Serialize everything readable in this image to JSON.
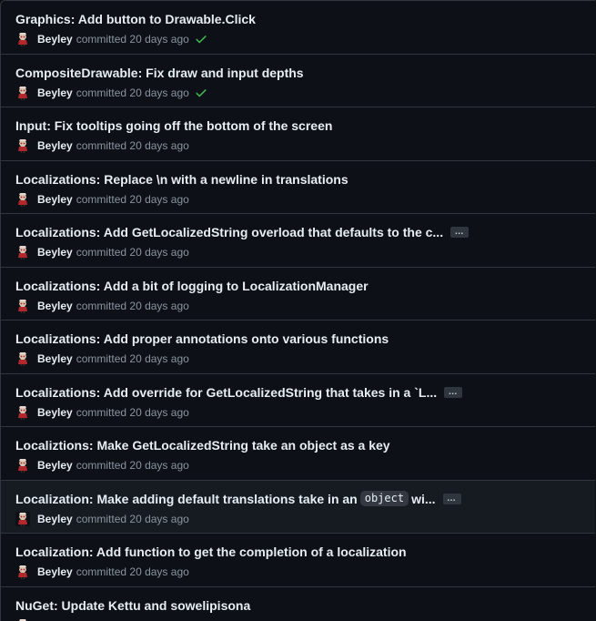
{
  "commits": [
    {
      "title": "Graphics: Add button to Drawable.Click",
      "author": "Beyley",
      "action": "committed",
      "time": "20 days ago",
      "status": "success",
      "truncated": false
    },
    {
      "title": "CompositeDrawable: Fix draw and input depths",
      "author": "Beyley",
      "action": "committed",
      "time": "20 days ago",
      "status": "success",
      "truncated": false
    },
    {
      "title": "Input: Fix tooltips going off the bottom of the screen",
      "author": "Beyley",
      "action": "committed",
      "time": "20 days ago",
      "status": "",
      "truncated": false
    },
    {
      "title": "Localizations: Replace \\n with a newline in translations",
      "author": "Beyley",
      "action": "committed",
      "time": "20 days ago",
      "status": "",
      "truncated": false
    },
    {
      "title": "Localizations: Add GetLocalizedString overload that defaults to the c...",
      "author": "Beyley",
      "action": "committed",
      "time": "20 days ago",
      "status": "",
      "truncated": true
    },
    {
      "title": "Localizations: Add a bit of logging to LocalizationManager",
      "author": "Beyley",
      "action": "committed",
      "time": "20 days ago",
      "status": "",
      "truncated": false
    },
    {
      "title": "Localizations: Add proper annotations onto various functions",
      "author": "Beyley",
      "action": "committed",
      "time": "20 days ago",
      "status": "",
      "truncated": false
    },
    {
      "title": "Localizations: Add override for GetLocalizedString that takes in a `L...",
      "author": "Beyley",
      "action": "committed",
      "time": "20 days ago",
      "status": "",
      "truncated": true
    },
    {
      "title": "Localiztions: Make GetLocalizedString take an object as a key",
      "author": "Beyley",
      "action": "committed",
      "time": "20 days ago",
      "status": "",
      "truncated": false
    },
    {
      "title": "Localization: Make adding default translations take in an",
      "code": "object",
      "title_after": "wi...",
      "author": "Beyley",
      "action": "committed",
      "time": "20 days ago",
      "status": "",
      "truncated": true,
      "highlighted": true
    },
    {
      "title": "Localization: Add function to get the completion of a localization",
      "author": "Beyley",
      "action": "committed",
      "time": "20 days ago",
      "status": "",
      "truncated": false
    },
    {
      "title": "NuGet: Update Kettu and sowelipisona",
      "author": "Beyley",
      "action": "committed",
      "time": "20 days ago",
      "status": "",
      "truncated": false
    }
  ],
  "ellipsis_label": "…",
  "colors": {
    "success": "#3fb950",
    "border": "#30363d",
    "background": "#0d1117",
    "muted": "#8b949e"
  }
}
